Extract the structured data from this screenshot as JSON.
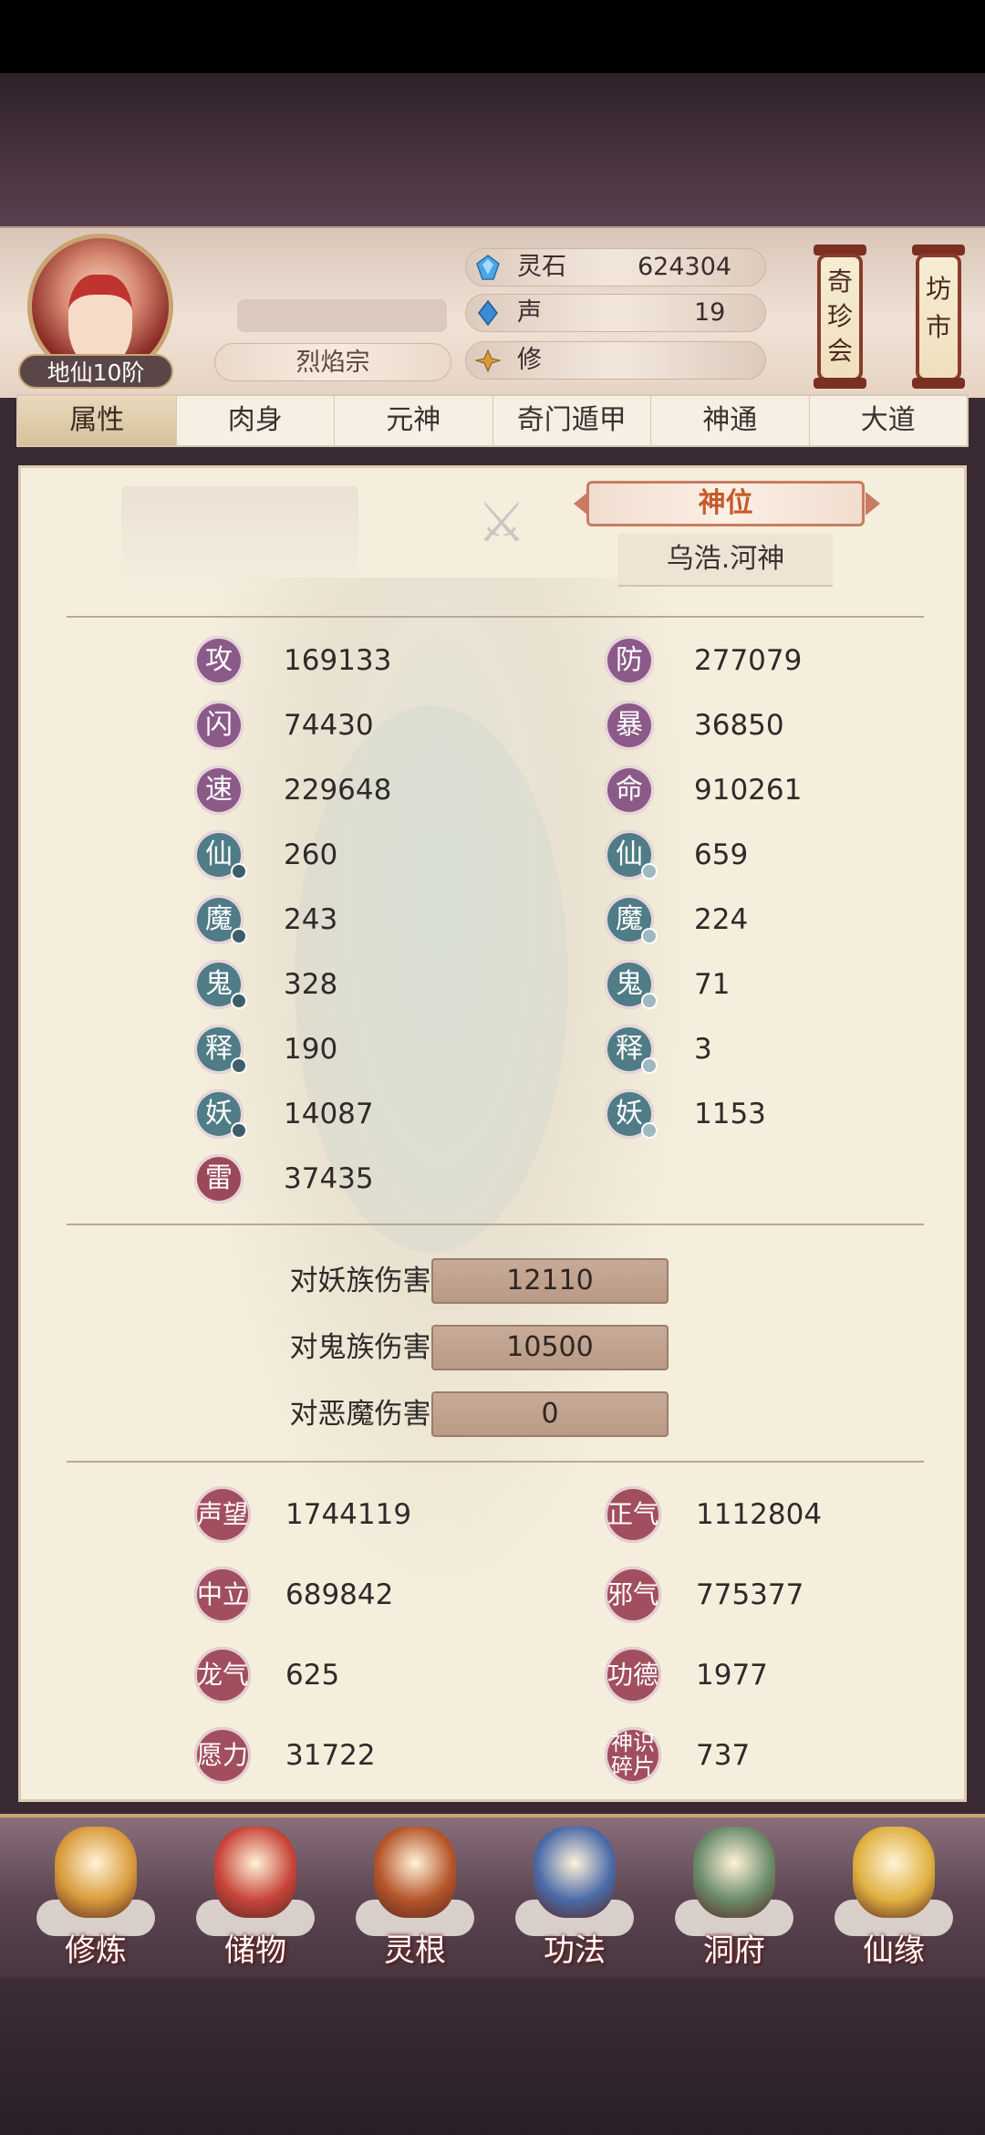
{
  "header": {
    "rank": "地仙10阶",
    "sect": "烈焰宗",
    "resources": [
      {
        "label": "灵石",
        "value": "624304",
        "icon": "spirit-stone-icon"
      },
      {
        "label": "声",
        "value": "19",
        "icon": "crystal-icon"
      },
      {
        "label": "修",
        "value": "",
        "icon": "cultivation-icon"
      }
    ],
    "side_buttons": [
      {
        "label": "奇珍会"
      },
      {
        "label": "坊市"
      }
    ]
  },
  "tabs": [
    "属性",
    "肉身",
    "元神",
    "奇门遁甲",
    "神通",
    "大道"
  ],
  "active_tab": "属性",
  "god_position": {
    "title": "神位",
    "name": "乌浩.河神"
  },
  "stats_left": [
    {
      "glyph": "攻",
      "value": "169133"
    },
    {
      "glyph": "闪",
      "value": "74430"
    },
    {
      "glyph": "速",
      "value": "229648"
    },
    {
      "glyph": "仙",
      "value": "260"
    },
    {
      "glyph": "魔",
      "value": "243"
    },
    {
      "glyph": "鬼",
      "value": "328"
    },
    {
      "glyph": "释",
      "value": "190"
    },
    {
      "glyph": "妖",
      "value": "14087"
    },
    {
      "glyph": "雷",
      "value": "37435"
    }
  ],
  "stats_right": [
    {
      "glyph": "防",
      "value": "277079"
    },
    {
      "glyph": "暴",
      "value": "36850"
    },
    {
      "glyph": "命",
      "value": "910261"
    },
    {
      "glyph": "仙",
      "value": "659"
    },
    {
      "glyph": "魔",
      "value": "224"
    },
    {
      "glyph": "鬼",
      "value": "71"
    },
    {
      "glyph": "释",
      "value": "3"
    },
    {
      "glyph": "妖",
      "value": "1153"
    }
  ],
  "damage": [
    {
      "label": "对妖族伤害:",
      "value": "12110"
    },
    {
      "label": "对鬼族伤害:",
      "value": "10500"
    },
    {
      "label": "对恶魔伤害:",
      "value": "0"
    }
  ],
  "reputation_left": [
    {
      "label": "声望",
      "value": "1744119"
    },
    {
      "label": "中立",
      "value": "689842"
    },
    {
      "label": "龙气",
      "value": "625"
    },
    {
      "label": "愿力",
      "value": "31722"
    }
  ],
  "reputation_right": [
    {
      "label": "正气",
      "value": "1112804"
    },
    {
      "label": "邪气",
      "value": "775377"
    },
    {
      "label": "功德",
      "value": "1977"
    },
    {
      "label": "神识碎片",
      "value": "737"
    }
  ],
  "bottom_nav": [
    {
      "label": "修炼",
      "color": "#d99a3a"
    },
    {
      "label": "储物",
      "color": "#c8443a"
    },
    {
      "label": "灵根",
      "color": "#b5542a"
    },
    {
      "label": "功法",
      "color": "#4a6aa8"
    },
    {
      "label": "洞府",
      "color": "#6a8a6a"
    },
    {
      "label": "仙缘",
      "color": "#e0b040"
    }
  ],
  "colors": {
    "accent": "#c55a2a",
    "panel": "#f6eedd",
    "stat_purple": "#8b5a88",
    "stat_teal": "#4f7c86",
    "rep_rose": "#a14e5e"
  }
}
